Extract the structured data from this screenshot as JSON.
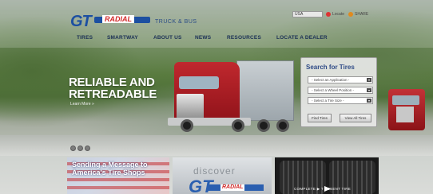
{
  "brand": {
    "logo_letters": "GT",
    "logo_word": "RADIAL",
    "tagline": "TRUCK & BUS"
  },
  "top_tools": {
    "region_select": "USA",
    "link_1": "Locate",
    "link_2": "SHARE"
  },
  "nav": {
    "items": [
      "TIRES",
      "SMARTWAY",
      "ABOUT US",
      "NEWS",
      "RESOURCES",
      "LOCATE A DEALER"
    ]
  },
  "hero": {
    "title_line1": "RELIABLE AND",
    "title_line2": "RETREADABLE",
    "link": "Learn More »"
  },
  "search": {
    "title": "Search for Tires",
    "select_application": "- Select an Application -",
    "select_wheel_position": "- Select a Wheel Position -",
    "select_tire_size": "- Select a Tire Size -",
    "find_button": "Find Tires",
    "view_all_button": "View All Tires"
  },
  "cards": {
    "card1_text": "Sending a Message to America's Tire Shops",
    "card2_text": "discover",
    "card2_logo": "GT",
    "card2_word": "RADIAL",
    "card3_text": "COMPLETE  ▶  T   ESSENT  TIRE"
  },
  "colors": {
    "brand_blue": "#1c4fa1",
    "brand_red": "#d22a2a",
    "nav_text": "#1a2f55",
    "search_title": "#2e4a86"
  }
}
